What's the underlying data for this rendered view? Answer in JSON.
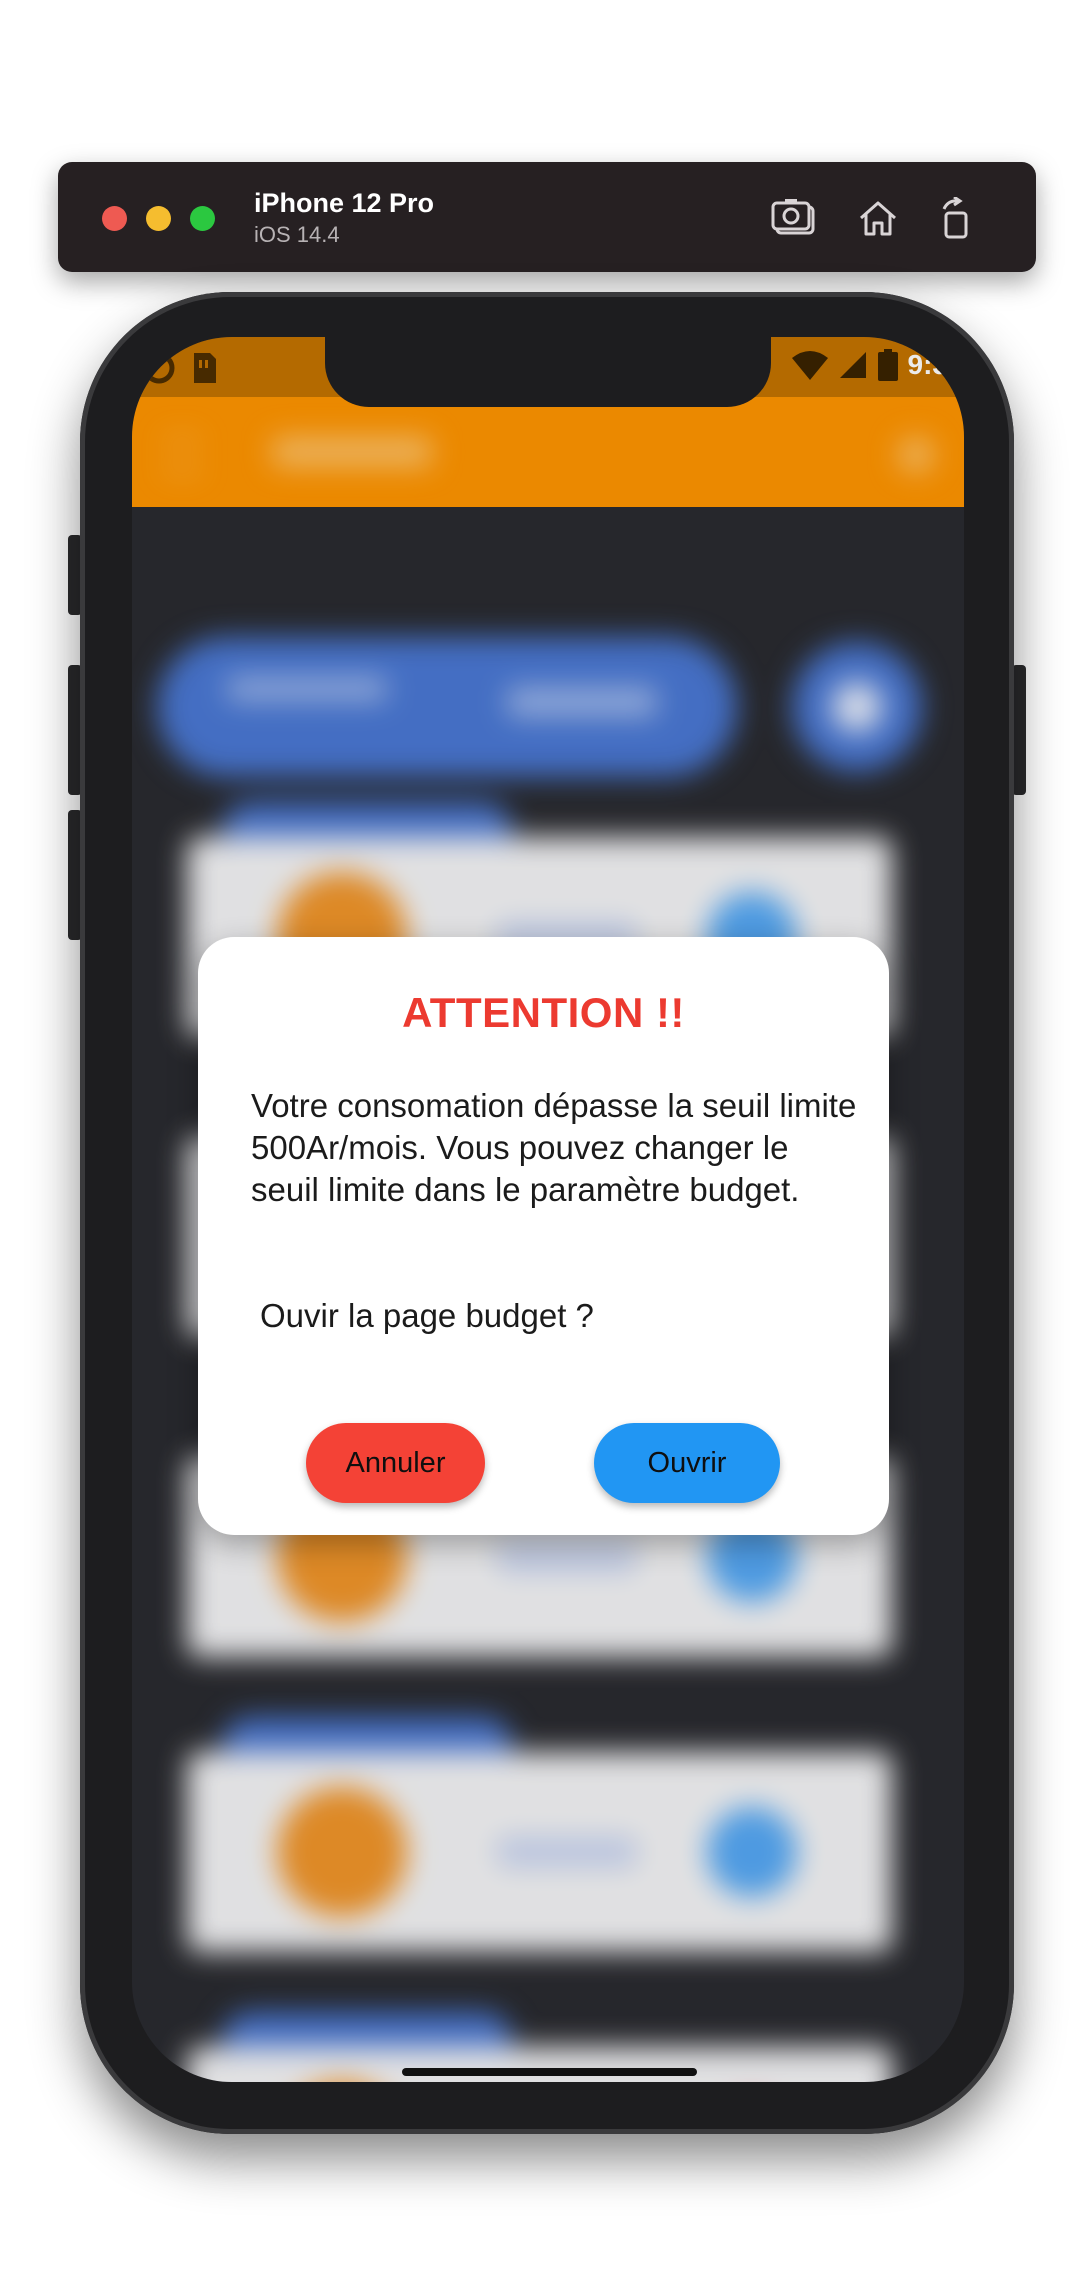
{
  "simulator": {
    "device_name": "iPhone 12 Pro",
    "os_version": "iOS 14.4",
    "icons": [
      "screenshot-icon",
      "home-icon",
      "rotate-icon"
    ]
  },
  "status_bar": {
    "time": "9:3",
    "icons": [
      "clock-icon",
      "sim-card-icon",
      "wifi-icon",
      "signal-icon",
      "battery-icon"
    ]
  },
  "colors": {
    "app_bar": "#ff9500",
    "status_bar": "#c47300",
    "dialog_title": "#ec3a30",
    "cancel_button": "#f44236",
    "open_button": "#2196f3"
  },
  "dialog": {
    "title": "ATTENTION !!",
    "message": "Votre consomation dépasse la seuil limite 500Ar/mois. Vous pouvez changer le seuil limite dans le paramètre budget.",
    "question": "Ouvir la page budget ?",
    "cancel_label": "Annuler",
    "open_label": "Ouvrir"
  }
}
